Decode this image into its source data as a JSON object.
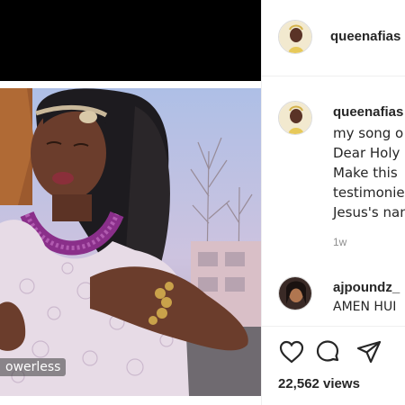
{
  "post": {
    "author": "queenafias",
    "caption_lines": [
      "my song o",
      "Dear Holy",
      "Make this",
      "testimonie",
      "Jesus's nan"
    ],
    "time_ago": "1w",
    "video_overlay_text": "owerless",
    "views": "22,562 views"
  },
  "comment": {
    "author": "ajpoundz_",
    "text": "AMEN HUI"
  },
  "actions": {
    "like_icon": "heart-icon",
    "comment_icon": "comment-icon",
    "share_icon": "paper-plane-icon"
  },
  "colors": {
    "text": "#262626",
    "muted": "#8e8e8e",
    "divider": "#efefef",
    "media_top": "#000000"
  }
}
